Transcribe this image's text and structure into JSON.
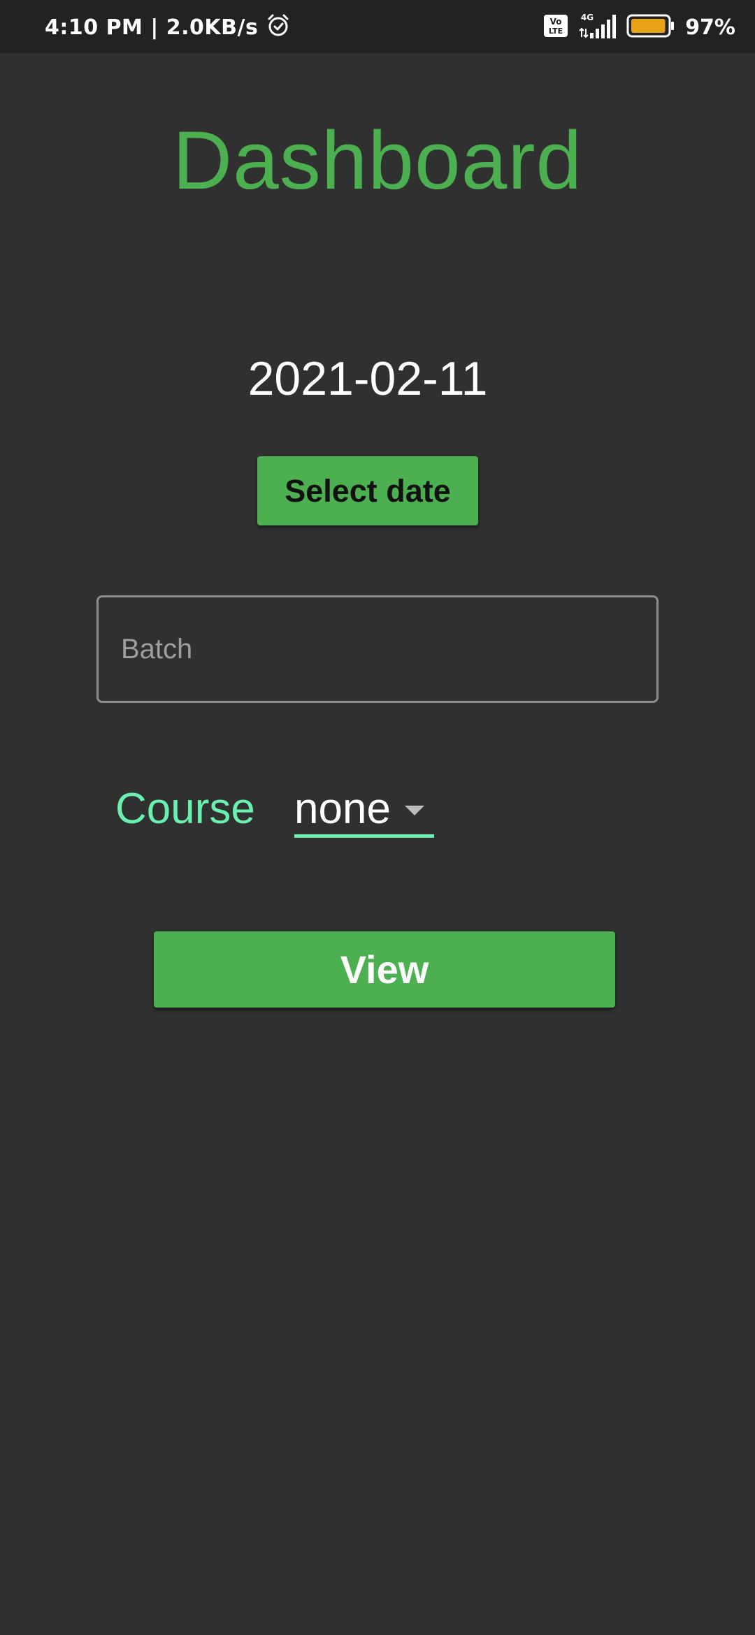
{
  "status_bar": {
    "time_speed": "4:10 PM | 2.0KB/s",
    "alarm_icon": "alarm-clock-icon",
    "volte_icon": "volte-lte-icon",
    "network_icon": "4g-signal-icon",
    "battery_icon": "battery-icon",
    "battery_level": 0.97,
    "battery_percent": "97%"
  },
  "page": {
    "title": "Dashboard",
    "selected_date": "2021-02-11",
    "select_date_label": "Select date",
    "batch": {
      "placeholder": "Batch",
      "value": ""
    },
    "course": {
      "label": "Course",
      "selected": "none"
    },
    "view_label": "View"
  },
  "colors": {
    "background": "#303030",
    "status_bar": "#222222",
    "accent_green": "#4caf50",
    "course_accent": "#69f0ae",
    "battery_fill": "#e8a317"
  }
}
